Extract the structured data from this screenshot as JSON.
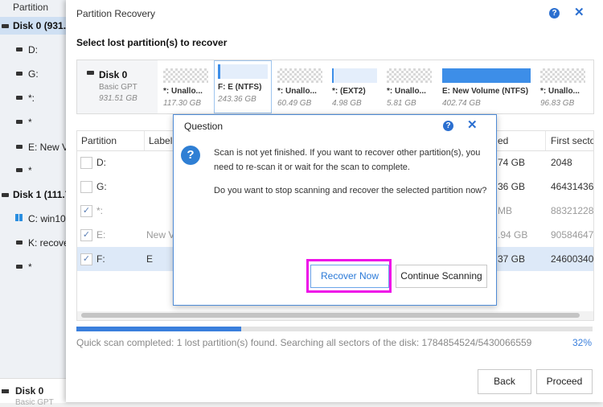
{
  "sidebar": {
    "header": "Partition",
    "disk0_label": "Disk 0 (931.5",
    "disk0_items": [
      "D:",
      "G:",
      "*:",
      "*",
      "E: New Vo",
      "*"
    ],
    "disk1_label": "Disk 1 (111.7",
    "disk1_items": [
      "C: win10",
      "K: recove",
      "*"
    ],
    "bottom_disk": "Disk 0",
    "bottom_type": "Basic GPT"
  },
  "dialog": {
    "title": "Partition Recovery",
    "subtitle": "Select lost partition(s) to recover",
    "help_icon": "?",
    "close_icon": "✕"
  },
  "disk_map": {
    "disk_name": "Disk 0",
    "disk_type": "Basic GPT",
    "disk_size": "931.51 GB",
    "partitions": [
      {
        "label": "*: Unallo...",
        "size": "117.30 GB",
        "kind": "unalloc",
        "fill": 0
      },
      {
        "label": "F: E (NTFS)",
        "size": "243.36 GB",
        "kind": "used",
        "fill": 0.05,
        "selected": true
      },
      {
        "label": "*: Unallo...",
        "size": "60.49 GB",
        "kind": "unalloc",
        "fill": 0
      },
      {
        "label": "*: (EXT2)",
        "size": "4.98 GB",
        "kind": "used",
        "fill": 0.03
      },
      {
        "label": "*: Unallo...",
        "size": "5.81 GB",
        "kind": "unalloc",
        "fill": 0
      },
      {
        "label": "E: New Volume (NTFS)",
        "size": "402.74 GB",
        "kind": "used",
        "fill": 1.0
      },
      {
        "label": "*: Unallo...",
        "size": "96.83 GB",
        "kind": "unalloc",
        "fill": 0
      }
    ]
  },
  "table": {
    "headers": {
      "partition": "Partition",
      "label": "Label",
      "size": "ed",
      "first_sector": "First secto"
    },
    "rows": [
      {
        "partition": "D:",
        "label": "",
        "size": "74 GB",
        "first_sector": "2048",
        "checked": false,
        "enabled": true,
        "selected": false
      },
      {
        "partition": "G:",
        "label": "",
        "size": "36 GB",
        "first_sector": "46431436",
        "checked": false,
        "enabled": true,
        "selected": false
      },
      {
        "partition": "*:",
        "label": "",
        "size": "MB",
        "first_sector": "88321228",
        "checked": true,
        "enabled": false,
        "selected": false
      },
      {
        "partition": "E:",
        "label": "New V",
        "size": ".94 GB",
        "first_sector": "90584647",
        "checked": true,
        "enabled": false,
        "selected": false
      },
      {
        "partition": "F:",
        "label": "E",
        "size": "37 GB",
        "first_sector": "24600340",
        "checked": true,
        "enabled": true,
        "selected": true
      }
    ]
  },
  "scan": {
    "progress": 0.32,
    "status": "Quick scan completed: 1 lost partition(s) found. Searching all sectors of the disk: 1784854524/5430066559",
    "percent": "32%"
  },
  "buttons": {
    "back": "Back",
    "proceed": "Proceed"
  },
  "question": {
    "title": "Question",
    "message1": "Scan is not yet finished. If you want to recover other partition(s), you need to re-scan it or wait for the scan to complete.",
    "message2": "Do you want to stop scanning and recover the selected partition now?",
    "recover_now": "Recover Now",
    "continue_scanning": "Continue Scanning",
    "info_icon": "?",
    "help_icon": "?",
    "close_icon": "✕"
  },
  "colors": {
    "accent": "#2b6fd0",
    "highlight": "#ee0ee8",
    "progress": "#3a7fdc"
  }
}
